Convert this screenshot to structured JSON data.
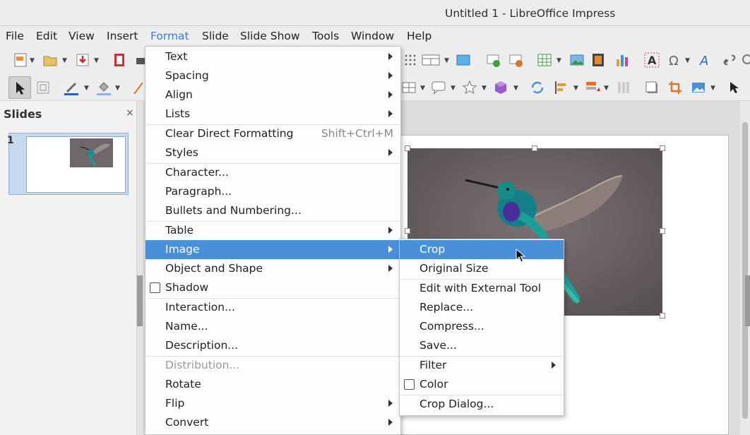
{
  "window": {
    "title": "Untitled 1 - LibreOffice Impress"
  },
  "menubar": {
    "items": [
      {
        "label": "File"
      },
      {
        "label": "Edit"
      },
      {
        "label": "View"
      },
      {
        "label": "Insert"
      },
      {
        "label": "Format"
      },
      {
        "label": "Slide"
      },
      {
        "label": "Slide Show"
      },
      {
        "label": "Tools"
      },
      {
        "label": "Window"
      },
      {
        "label": "Help"
      }
    ],
    "active": "Format"
  },
  "slides_panel": {
    "title": "Slides",
    "close_symbol": "×",
    "slides": [
      {
        "number": "1"
      }
    ]
  },
  "format_menu": {
    "items": [
      {
        "label": "Text",
        "submenu": true
      },
      {
        "label": "Spacing",
        "submenu": true
      },
      {
        "label": "Align",
        "submenu": true
      },
      {
        "label": "Lists",
        "submenu": true
      },
      {
        "label": "Clear Direct Formatting",
        "shortcut": "Shift+Ctrl+M"
      },
      {
        "label": "Styles",
        "submenu": true
      },
      {
        "label": "Character..."
      },
      {
        "label": "Paragraph..."
      },
      {
        "label": "Bullets and Numbering..."
      },
      {
        "label": "Table",
        "submenu": true
      },
      {
        "label": "Image",
        "submenu": true,
        "highlighted": true
      },
      {
        "label": "Object and Shape",
        "submenu": true
      },
      {
        "label": "Shadow",
        "checkbox": true,
        "checked": false
      },
      {
        "label": "Interaction..."
      },
      {
        "label": "Name..."
      },
      {
        "label": "Description..."
      },
      {
        "label": "Distribution...",
        "disabled": true
      },
      {
        "label": "Rotate"
      },
      {
        "label": "Flip",
        "submenu": true
      },
      {
        "label": "Convert",
        "submenu": true
      }
    ]
  },
  "image_submenu": {
    "items": [
      {
        "label": "Crop",
        "highlighted": true
      },
      {
        "label": "Original Size"
      },
      {
        "label": "Edit with External Tool"
      },
      {
        "label": "Replace..."
      },
      {
        "label": "Compress..."
      },
      {
        "label": "Save..."
      },
      {
        "label": "Filter",
        "submenu": true
      },
      {
        "label": "Color",
        "checkbox": true,
        "checked": false
      },
      {
        "label": "Crop Dialog..."
      }
    ]
  },
  "colors": {
    "highlight": "#4a90d9",
    "active_menu_text": "#3a7bd5"
  }
}
